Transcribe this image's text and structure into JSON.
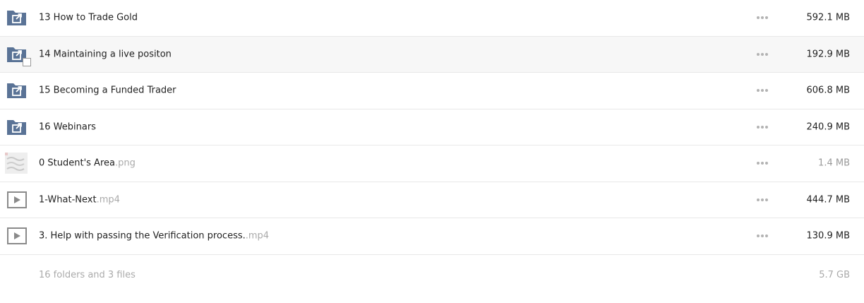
{
  "rows": [
    {
      "name": "13 How to Trade Gold",
      "ext": "",
      "size": "592.1 MB",
      "type": "shared-folder"
    },
    {
      "name": "14 Maintaining a live positon",
      "ext": "",
      "size": "192.9 MB",
      "type": "shared-folder"
    },
    {
      "name": "15 Becoming a Funded Trader",
      "ext": "",
      "size": "606.8 MB",
      "type": "shared-folder"
    },
    {
      "name": "16 Webinars",
      "ext": "",
      "size": "240.9 MB",
      "type": "shared-folder"
    },
    {
      "name": "0 Student's Area",
      "ext": ".png",
      "size": "1.4 MB",
      "type": "image"
    },
    {
      "name": "1-What-Next",
      "ext": ".mp4",
      "size": "444.7 MB",
      "type": "video"
    },
    {
      "name": "3. Help with passing the Verification process.",
      "ext": ".mp4",
      "size": "130.9 MB",
      "type": "video"
    }
  ],
  "summary": {
    "text": "16 folders and 3 files",
    "size": "5.7 GB"
  },
  "colors": {
    "folder": "#5a7396",
    "more_dots": "#b3b3b3"
  }
}
